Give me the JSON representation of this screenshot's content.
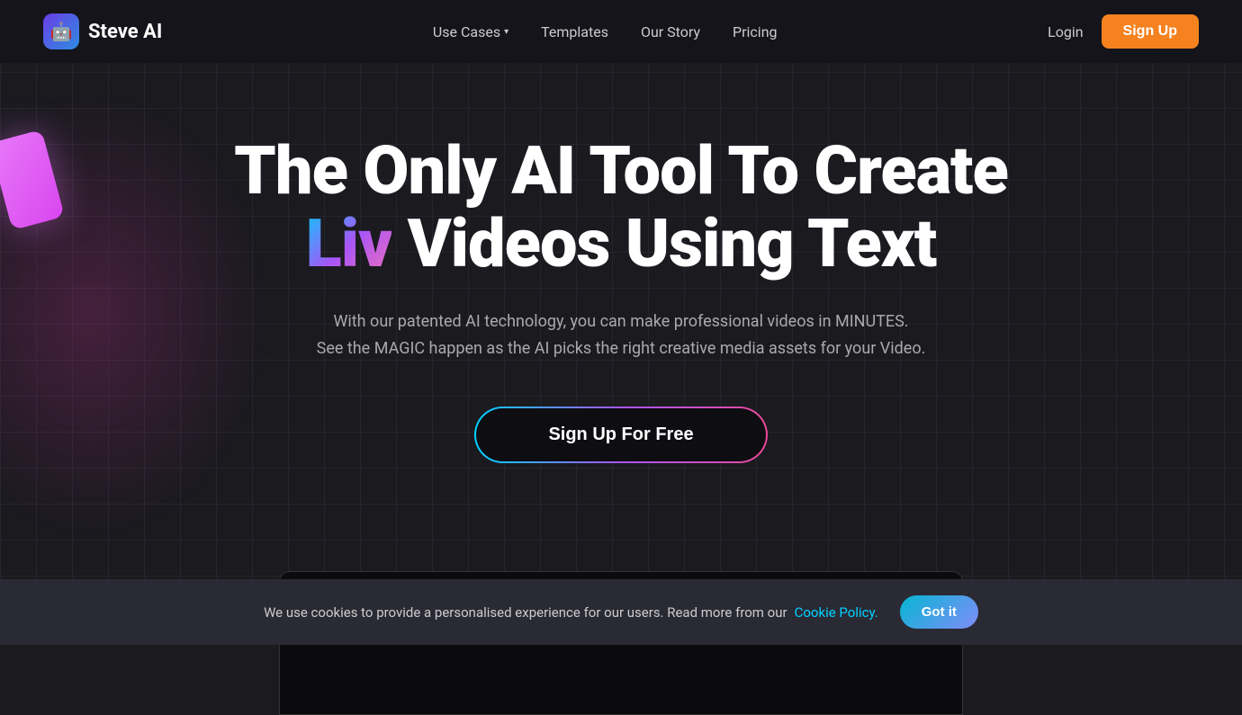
{
  "brand": {
    "logo_emoji": "🤖",
    "name": "Steve AI"
  },
  "nav": {
    "links": [
      {
        "id": "use-cases",
        "label": "Use Cases",
        "has_dropdown": true
      },
      {
        "id": "templates",
        "label": "Templates",
        "has_dropdown": false
      },
      {
        "id": "our-story",
        "label": "Our Story",
        "has_dropdown": false
      },
      {
        "id": "pricing",
        "label": "Pricing",
        "has_dropdown": false
      }
    ],
    "login_label": "Login",
    "signup_label": "Sign Up"
  },
  "hero": {
    "title_part1": "The Only AI Tool To Create",
    "title_colored": "Liv",
    "title_part2": "Videos Using Text",
    "subtitle_line1": "With our patented AI technology, you can make professional videos in MINUTES.",
    "subtitle_line2": "See the MAGIC happen as the AI picks the right creative media assets for your Video.",
    "cta_label": "Sign Up For Free"
  },
  "cookie": {
    "text": "We use cookies to provide a personalised experience for our users. Read more from our",
    "link_label": "Cookie Policy.",
    "button_label": "Got it"
  }
}
